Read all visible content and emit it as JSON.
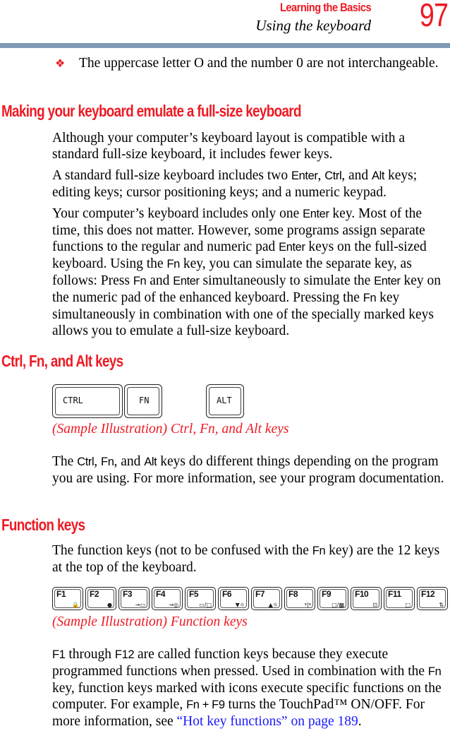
{
  "header": {
    "section": "Learning the Basics",
    "subsection": "Using the keyboard",
    "page_number": "97"
  },
  "bullet": {
    "icon": "diamond-bullet-icon",
    "text": "The uppercase letter O and the number 0 are not interchangeable."
  },
  "section1": {
    "heading": "Making your keyboard emulate a full-size keyboard",
    "p1": "Although your computer’s keyboard layout is compatible with a standard full-size keyboard, it includes fewer keys.",
    "p2": {
      "a": "A standard full-size keyboard includes two ",
      "k1": "Enter",
      "b": ", ",
      "k2": "Ctrl",
      "c": ", and ",
      "k3": "Alt",
      "d": " keys; editing keys; cursor positioning keys; and a numeric keypad."
    },
    "p3": {
      "a": "Your computer’s keyboard includes only one ",
      "k1": "Enter",
      "b": " key. Most of the time, this does not matter. However, some programs assign separate functions to the regular and numeric pad ",
      "k2": "Enter",
      "c": " keys on the full-sized keyboard. Using the ",
      "k3": "Fn",
      "d": " key, you can simulate the separate key, as follows: Press ",
      "k4": "Fn",
      "e": " and ",
      "k5": "Enter",
      "f": " simultaneously to simulate the ",
      "k6": "Enter",
      "g": " key on the numeric pad of the enhanced keyboard. Pressing the ",
      "k7": "Fn",
      "h": " key simultaneously in combination with one of the specially marked keys allows you to emulate a full-size keyboard."
    }
  },
  "section2": {
    "heading": "Ctrl, Fn, and Alt keys",
    "keys": [
      "CTRL",
      "FN",
      "ALT"
    ],
    "caption": "(Sample Illustration) Ctrl, Fn, and Alt keys",
    "p1": {
      "a": "The ",
      "k1": "Ctrl",
      "b": ", ",
      "k2": "Fn",
      "c": ", and ",
      "k3": "Alt",
      "d": " keys do different things depending on the program you are using. For more information, see your program documentation."
    }
  },
  "section3": {
    "heading": "Function keys",
    "p1": {
      "a": "The function keys (not to be confused with the ",
      "k1": "Fn",
      "b": " key) are the 12 keys at the top of the keyboard."
    },
    "fkeys": [
      {
        "label": "F1",
        "icon": "lock-icon",
        "glyph": "🔒"
      },
      {
        "label": "F2",
        "icon": "power-plan-icon",
        "glyph": "●"
      },
      {
        "label": "F3",
        "icon": "sleep-icon",
        "glyph": "→▭"
      },
      {
        "label": "F4",
        "icon": "hibernate-icon",
        "glyph": "→◎"
      },
      {
        "label": "F5",
        "icon": "display-switch-icon",
        "glyph": "▭/□"
      },
      {
        "label": "F6",
        "icon": "brightness-down-icon",
        "glyph": "▼☼"
      },
      {
        "label": "F7",
        "icon": "brightness-up-icon",
        "glyph": "▲☼"
      },
      {
        "label": "F8",
        "icon": "wireless-icon",
        "glyph": "ᵠ|ᵠ"
      },
      {
        "label": "F9",
        "icon": "touchpad-icon",
        "glyph": "□/▩"
      },
      {
        "label": "F10",
        "icon": "arrow-mode-icon",
        "glyph": "⊡"
      },
      {
        "label": "F11",
        "icon": "numeric-mode-icon",
        "glyph": "□"
      },
      {
        "label": "F12",
        "icon": "scroll-lock-icon",
        "glyph": "⇅"
      }
    ],
    "caption": "(Sample Illustration) Function keys",
    "p2": {
      "k1": "F1",
      "a": " through ",
      "k2": "F12",
      "b": " are called function keys because they execute programmed functions when pressed. Used in combination with the ",
      "k3": "Fn",
      "c": " key, function keys marked with icons execute specific functions on the computer. For example, ",
      "k4": "Fn + F9",
      "d": " turns the TouchPad™ ON/OFF. For more information, see ",
      "link": "“Hot key functions” on page 189",
      "e": "."
    }
  }
}
